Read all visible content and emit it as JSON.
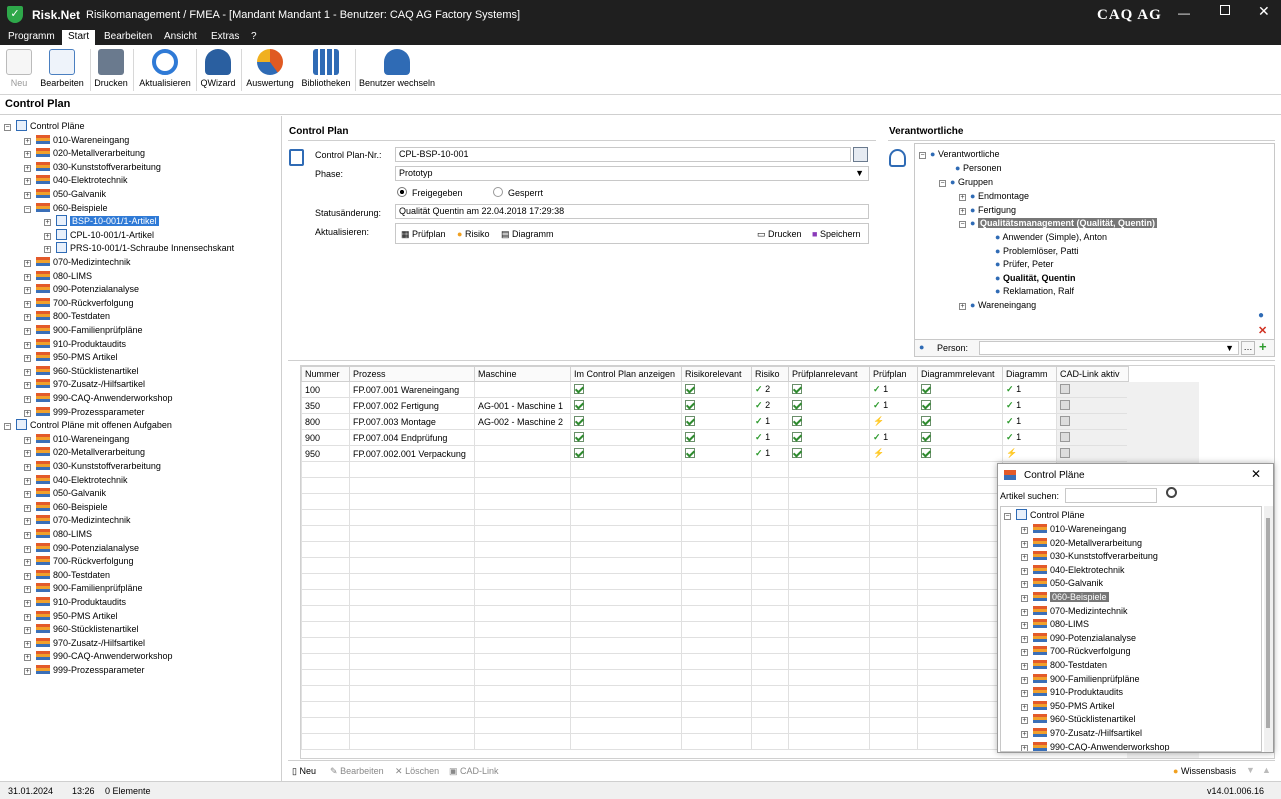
{
  "titlebar": {
    "app": "Risk.Net",
    "title": "Risikomanagement / FMEA - [Mandant Mandant 1 - Benutzer: CAQ AG Factory Systems]",
    "brand": "CAQ AG"
  },
  "menu": [
    "Programm",
    "Start",
    "Bearbeiten",
    "Ansicht",
    "Extras",
    "?"
  ],
  "ribbon": [
    {
      "label": "Neu",
      "icon": "new-icon"
    },
    {
      "label": "Bearbeiten",
      "icon": "edit-icon"
    },
    {
      "label": "Drucken",
      "icon": "print-icon"
    },
    {
      "label": "Aktualisieren",
      "icon": "refresh-icon"
    },
    {
      "label": "QWizard",
      "icon": "wizard-icon"
    },
    {
      "label": "Auswertung",
      "icon": "pie-chart-icon"
    },
    {
      "label": "Bibliotheken",
      "icon": "library-icon"
    },
    {
      "label": "Benutzer wechseln",
      "icon": "switch-user-icon"
    }
  ],
  "page_title": "Control Plan",
  "tree": {
    "root1": "Control Pläne",
    "group1": [
      "010-Wareneingang",
      "020-Metallverarbeitung",
      "030-Kunststoffverarbeitung",
      "040-Elektrotechnik",
      "050-Galvanik",
      "060-Beispiele"
    ],
    "docs": [
      "BSP-10-001/1-Artikel",
      "CPL-10-001/1-Artikel",
      "PRS-10-001/1-Schraube Innensechskant"
    ],
    "group1b": [
      "070-Medizintechnik",
      "080-LIMS",
      "090-Potenzialanalyse",
      "700-Rückverfolgung",
      "800-Testdaten",
      "900-Familienprüfpläne",
      "910-Produktaudits",
      "950-PMS Artikel",
      "960-Stücklistenartikel",
      "970-Zusatz-/Hilfsartikel",
      "990-CAQ-Anwenderworkshop",
      "999-Prozessparameter"
    ],
    "root2": "Control Pläne mit offenen Aufgaben",
    "group2": [
      "010-Wareneingang",
      "020-Metallverarbeitung",
      "030-Kunststoffverarbeitung",
      "040-Elektrotechnik",
      "050-Galvanik",
      "060-Beispiele",
      "070-Medizintechnik",
      "080-LIMS",
      "090-Potenzialanalyse",
      "700-Rückverfolgung",
      "800-Testdaten",
      "900-Familienprüfpläne",
      "910-Produktaudits",
      "950-PMS Artikel",
      "960-Stücklistenartikel",
      "970-Zusatz-/Hilfsartikel",
      "990-CAQ-Anwenderworkshop",
      "999-Prozessparameter"
    ]
  },
  "form": {
    "section": "Control Plan",
    "nr_label": "Control Plan-Nr.:",
    "nr_value": "CPL-BSP-10-001",
    "phase_label": "Phase:",
    "phase_value": "Prototyp",
    "radio_on": "Freigegeben",
    "radio_off": "Gesperrt",
    "status_label": "Statusänderung:",
    "status_value": "Qualität Quentin am 22.04.2018 17:29:38",
    "update_label": "Aktualisieren:",
    "btn_pruefplan": "Prüfplan",
    "btn_risiko": "Risiko",
    "btn_diagramm": "Diagramm",
    "btn_drucken": "Drucken",
    "btn_speichern": "Speichern"
  },
  "resp": {
    "section": "Verantwortliche",
    "root": "Verantwortliche",
    "personen": "Personen",
    "gruppen": "Gruppen",
    "g1": "Endmontage",
    "g2": "Fertigung",
    "g3": "Qualitätsmanagement (Qualität, Quentin)",
    "members": [
      "Anwender (Simple), Anton",
      "Problemlöser, Patti",
      "Prüfer, Peter",
      "Qualität, Quentin",
      "Reklamation, Ralf"
    ],
    "g4": "Wareneingang",
    "person_label": "Person:"
  },
  "grid": {
    "headers": [
      "Nummer",
      "Prozess",
      "Maschine",
      "Im Control Plan anzeigen",
      "Risikorelevant",
      "Risiko",
      "Prüfplanrelevant",
      "Prüfplan",
      "Diagrammrelevant",
      "Diagramm",
      "CAD-Link aktiv"
    ],
    "rows": [
      {
        "nr": "100",
        "prozess": "FP.007.001 Wareneingang",
        "maschine": "",
        "risiko": "2",
        "pruefplan": "1",
        "diagramm": "1",
        "bolt_pp": false,
        "bolt_dg": false
      },
      {
        "nr": "350",
        "prozess": "FP.007.002 Fertigung",
        "maschine": "AG-001 - Maschine 1",
        "risiko": "2",
        "pruefplan": "1",
        "diagramm": "1",
        "bolt_pp": false,
        "bolt_dg": false
      },
      {
        "nr": "800",
        "prozess": "FP.007.003 Montage",
        "maschine": "AG-002 - Maschine 2",
        "risiko": "1",
        "pruefplan": "",
        "diagramm": "1",
        "bolt_pp": true,
        "bolt_dg": false
      },
      {
        "nr": "900",
        "prozess": "FP.007.004 Endprüfung",
        "maschine": "",
        "risiko": "1",
        "pruefplan": "1",
        "diagramm": "1",
        "bolt_pp": false,
        "bolt_dg": false
      },
      {
        "nr": "950",
        "prozess": "FP.007.002.001 Verpackung",
        "maschine": "",
        "risiko": "1",
        "pruefplan": "",
        "diagramm": "",
        "bolt_pp": true,
        "bolt_dg": true
      }
    ]
  },
  "gridfooter": {
    "neu": "Neu",
    "bearbeiten": "Bearbeiten",
    "loeschen": "Löschen",
    "cad": "CAD-Link",
    "wissen": "Wissensbasis"
  },
  "float": {
    "title": "Control Pläne",
    "search_label": "Artikel suchen:",
    "root": "Control Pläne",
    "items": [
      "010-Wareneingang",
      "020-Metallverarbeitung",
      "030-Kunststoffverarbeitung",
      "040-Elektrotechnik",
      "050-Galvanik",
      "060-Beispiele",
      "070-Medizintechnik",
      "080-LIMS",
      "090-Potenzialanalyse",
      "700-Rückverfolgung",
      "800-Testdaten",
      "900-Familienprüfpläne",
      "910-Produktaudits",
      "950-PMS Artikel",
      "960-Stücklistenartikel",
      "970-Zusatz-/Hilfsartikel",
      "990-CAQ-Anwenderworkshop"
    ]
  },
  "status": {
    "date": "31.01.2024",
    "time": "13:26",
    "elements": "0 Elemente",
    "version": "v14.01.006.16"
  }
}
